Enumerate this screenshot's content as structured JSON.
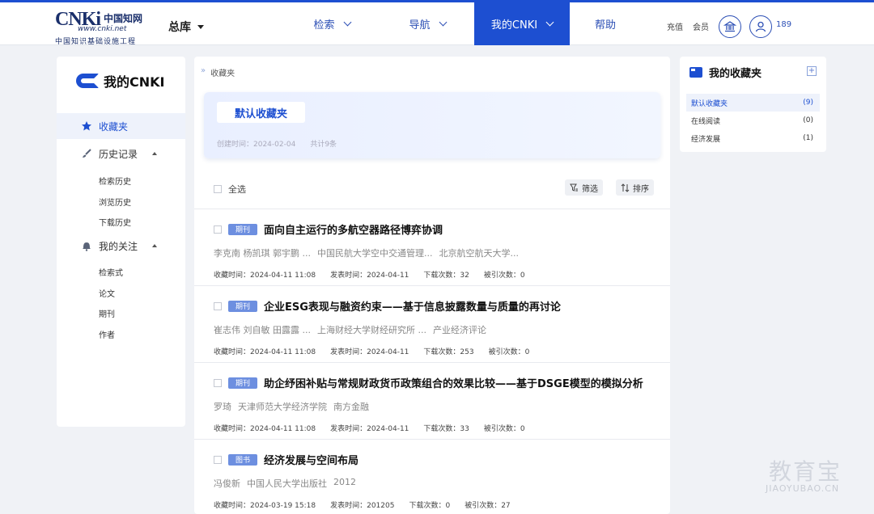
{
  "header": {
    "logo_text": "CNKi",
    "logo_cn": "中国知网",
    "logo_url": "www.cnki.net",
    "logo_sub": "中国知识基础设施工程",
    "library": "总库",
    "nav": [
      "检索",
      "导航",
      "我的CNKI",
      "帮助"
    ],
    "recharge": "充值",
    "member": "会员",
    "user_count": "189"
  },
  "sidebar": {
    "brand": "我的CNKI",
    "favorites": "收藏夹",
    "history": "历史记录",
    "history_items": [
      "检索历史",
      "浏览历史",
      "下载历史"
    ],
    "follow": "我的关注",
    "follow_items": [
      "检索式",
      "论文",
      "期刊",
      "作者"
    ]
  },
  "main": {
    "breadcrumb": "收藏夹",
    "folder": {
      "name": "默认收藏夹",
      "created": "创建时间：2024-02-04",
      "count": "共计9条"
    },
    "select_all": "全选",
    "filter": "筛选",
    "sort": "排序",
    "items": [
      {
        "type": "期刊",
        "title": "面向自主运行的多航空器路径博弈协调",
        "authors": "李克南 杨凯琪 郭宇鹏 ...",
        "org": "中国民航大学空中交通管理...",
        "source": "北京航空航天大学...",
        "collected": "收藏时间：2024-04-11 11:08",
        "published": "发表时间：2024-04-11",
        "downloads": "下载次数：32",
        "cited": "被引次数：0"
      },
      {
        "type": "期刊",
        "title": "企业ESG表现与融资约束——基于信息披露数量与质量的再讨论",
        "authors": "崔志伟 刘自敏 田露露 ...",
        "org": "上海财经大学财经研究所 ...",
        "source": "产业经济评论",
        "collected": "收藏时间：2024-04-11 11:08",
        "published": "发表时间：2024-04-11",
        "downloads": "下载次数：253",
        "cited": "被引次数：0"
      },
      {
        "type": "期刊",
        "title": "助企纾困补贴与常规财政货币政策组合的效果比较——基于DSGE模型的模拟分析",
        "authors": "罗琦",
        "org": "天津师范大学经济学院",
        "source": "南方金融",
        "collected": "收藏时间：2024-04-11 11:08",
        "published": "发表时间：2024-04-11",
        "downloads": "下载次数：33",
        "cited": "被引次数：0"
      },
      {
        "type": "图书",
        "title": "经济发展与空间布局",
        "authors": "冯俊新",
        "org": "中国人民大学出版社",
        "source": "2012",
        "collected": "收藏时间：2024-03-19 15:18",
        "published": "发表时间：201205",
        "downloads": "下载次数：0",
        "cited": "被引次数：27"
      }
    ]
  },
  "right": {
    "title": "我的收藏夹",
    "folders": [
      {
        "name": "默认收藏夹",
        "count": "(9)"
      },
      {
        "name": "在线阅读",
        "count": "(0)"
      },
      {
        "name": "经济发展",
        "count": "(1)"
      }
    ]
  },
  "watermark": {
    "cn": "教育宝",
    "en": "JIAOYUBAO.CN"
  },
  "colors": {
    "accent": "#1d4fd1",
    "badge": "#6d8fe0"
  }
}
